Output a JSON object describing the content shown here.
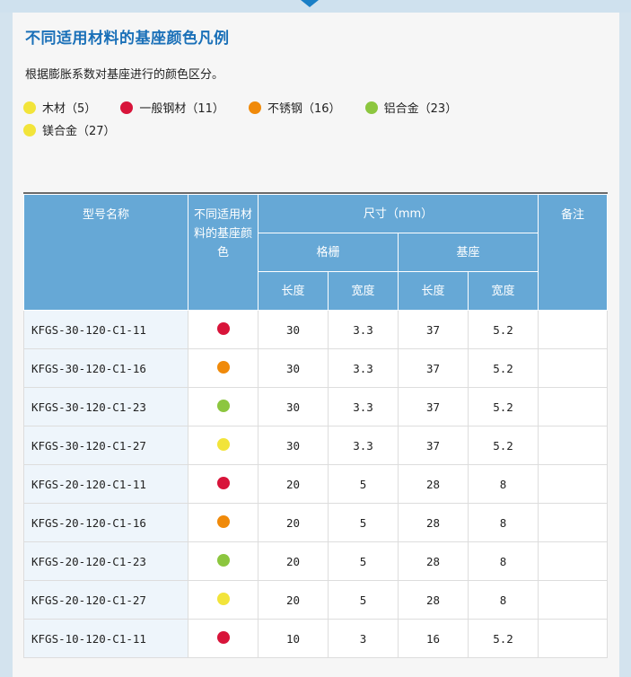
{
  "page": {
    "title": "不同适用材料的基座颜色凡例",
    "description": "根据膨胀系数对基座进行的颜色区分。"
  },
  "colors": {
    "wood": "#f2e43a",
    "steel": "#d8143a",
    "stainless": "#f08a0a",
    "aluminium": "#8cc63f",
    "magnesium": "#f2e43a",
    "header_bg": "#66a8d6",
    "title": "#1a70b8"
  },
  "legend": [
    {
      "label": "木材（5）",
      "color": "#f2e43a"
    },
    {
      "label": "一般钢材（11）",
      "color": "#d8143a"
    },
    {
      "label": "不锈钢（16）",
      "color": "#f08a0a"
    },
    {
      "label": "铝合金（23）",
      "color": "#8cc63f"
    },
    {
      "label": "镁合金（27）",
      "color": "#f2e43a"
    }
  ],
  "table": {
    "headers": {
      "model": "型号名称",
      "color": "不同适用材料的基座颜色",
      "size": "尺寸（mm）",
      "grating": "格栅",
      "base": "基座",
      "length1": "长度",
      "width1": "宽度",
      "length2": "长度",
      "width2": "宽度",
      "note": "备注"
    },
    "rows": [
      {
        "model": "KFGS-30-120-C1-11",
        "color": "#d8143a",
        "g_len": "30",
        "g_wid": "3.3",
        "b_len": "37",
        "b_wid": "5.2",
        "note": ""
      },
      {
        "model": "KFGS-30-120-C1-16",
        "color": "#f08a0a",
        "g_len": "30",
        "g_wid": "3.3",
        "b_len": "37",
        "b_wid": "5.2",
        "note": ""
      },
      {
        "model": "KFGS-30-120-C1-23",
        "color": "#8cc63f",
        "g_len": "30",
        "g_wid": "3.3",
        "b_len": "37",
        "b_wid": "5.2",
        "note": ""
      },
      {
        "model": "KFGS-30-120-C1-27",
        "color": "#f2e43a",
        "g_len": "30",
        "g_wid": "3.3",
        "b_len": "37",
        "b_wid": "5.2",
        "note": ""
      },
      {
        "model": "KFGS-20-120-C1-11",
        "color": "#d8143a",
        "g_len": "20",
        "g_wid": "5",
        "b_len": "28",
        "b_wid": "8",
        "note": ""
      },
      {
        "model": "KFGS-20-120-C1-16",
        "color": "#f08a0a",
        "g_len": "20",
        "g_wid": "5",
        "b_len": "28",
        "b_wid": "8",
        "note": ""
      },
      {
        "model": "KFGS-20-120-C1-23",
        "color": "#8cc63f",
        "g_len": "20",
        "g_wid": "5",
        "b_len": "28",
        "b_wid": "8",
        "note": ""
      },
      {
        "model": "KFGS-20-120-C1-27",
        "color": "#f2e43a",
        "g_len": "20",
        "g_wid": "5",
        "b_len": "28",
        "b_wid": "8",
        "note": ""
      },
      {
        "model": "KFGS-10-120-C1-11",
        "color": "#d8143a",
        "g_len": "10",
        "g_wid": "3",
        "b_len": "16",
        "b_wid": "5.2",
        "note": ""
      }
    ]
  }
}
